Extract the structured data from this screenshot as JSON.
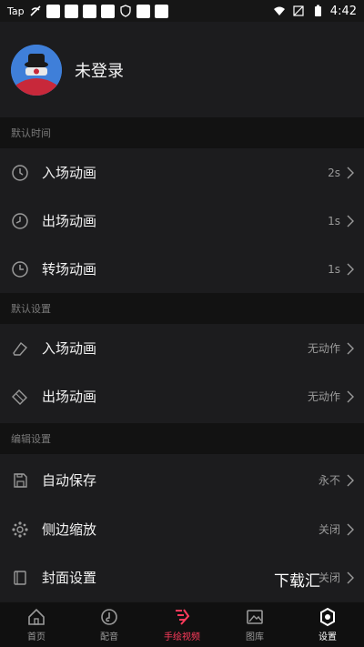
{
  "status_bar": {
    "carrier": "Tap",
    "time": "4:42"
  },
  "profile": {
    "username": "未登录"
  },
  "sections": {
    "default_time": "默认时间",
    "default_settings": "默认设置",
    "edit_settings": "编辑设置"
  },
  "rows": {
    "enter_anim": {
      "label": "入场动画",
      "value": "2s"
    },
    "exit_anim": {
      "label": "出场动画",
      "value": "1s"
    },
    "transition_anim": {
      "label": "转场动画",
      "value": "1s"
    },
    "default_enter_anim": {
      "label": "入场动画",
      "value": "无动作"
    },
    "default_exit_anim": {
      "label": "出场动画",
      "value": "无动作"
    },
    "auto_save": {
      "label": "自动保存",
      "value": "永不"
    },
    "side_zoom": {
      "label": "侧边缩放",
      "value": "关闭"
    },
    "cover_settings": {
      "label": "封面设置",
      "value": "关闭"
    }
  },
  "watermark": "下载汇",
  "nav": {
    "home": "首页",
    "music": "配音",
    "video": "手绘视频",
    "gallery": "图库",
    "settings": "设置"
  },
  "colors": {
    "accent": "#ff3b5c",
    "background": "#1c1c1e",
    "header_bg": "#121212"
  }
}
